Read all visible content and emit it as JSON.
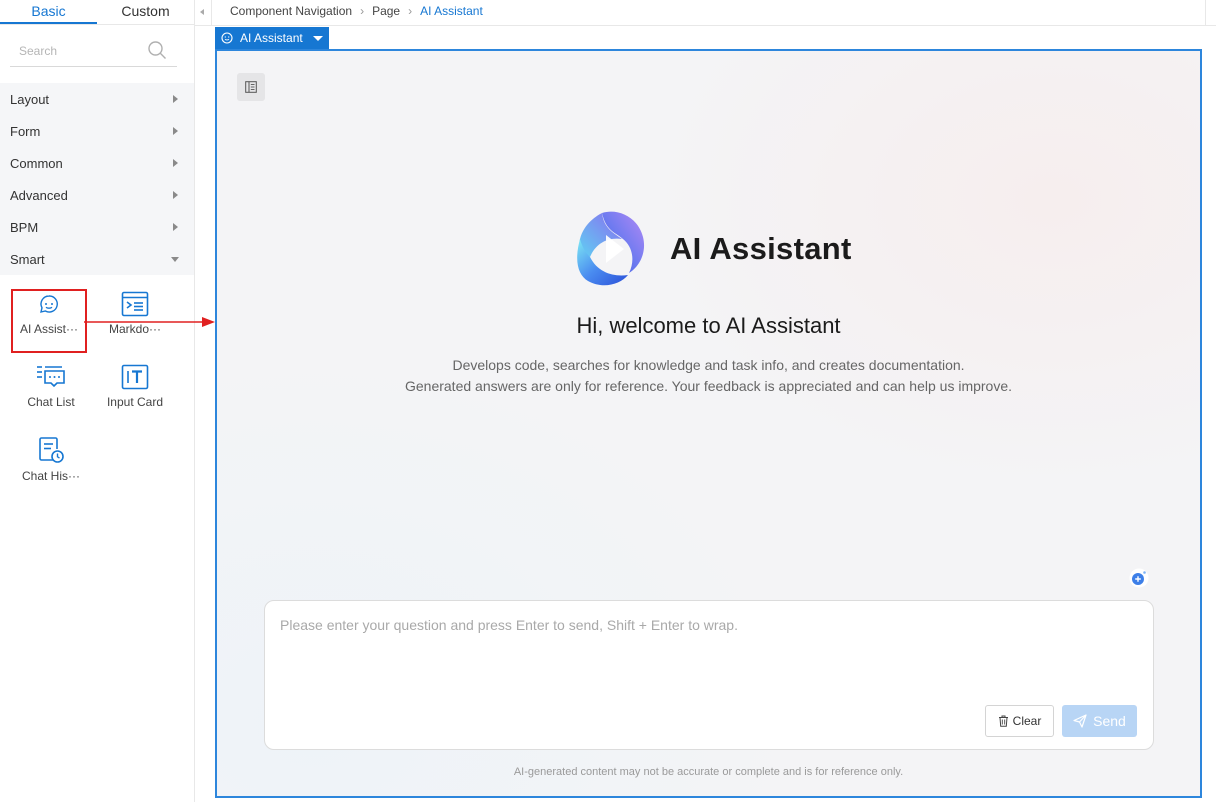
{
  "left_panel": {
    "tabs": [
      {
        "label": "Basic",
        "active": true
      },
      {
        "label": "Custom",
        "active": false
      }
    ],
    "search": {
      "placeholder": "Search",
      "value": ""
    },
    "categories": [
      {
        "label": "Layout",
        "expanded": false
      },
      {
        "label": "Form",
        "expanded": false
      },
      {
        "label": "Common",
        "expanded": false
      },
      {
        "label": "Advanced",
        "expanded": false
      },
      {
        "label": "BPM",
        "expanded": false
      },
      {
        "label": "Smart",
        "expanded": true
      }
    ],
    "components": [
      {
        "label": "AI Assist···",
        "icon": "ai-assistant-icon",
        "selected": true
      },
      {
        "label": "Markdo···",
        "icon": "markdown-icon",
        "selected": false
      },
      {
        "label": "Chat List",
        "icon": "chat-list-icon",
        "selected": false
      },
      {
        "label": "Input Card",
        "icon": "input-card-icon",
        "selected": false
      },
      {
        "label": "Chat His···",
        "icon": "chat-history-icon",
        "selected": false
      }
    ]
  },
  "breadcrumb": [
    "Component Navigation",
    "Page",
    "AI Assistant"
  ],
  "selected_tag": {
    "label": "AI Assistant",
    "icon": "smiley-chat-icon"
  },
  "canvas": {
    "brand_name": "AI Assistant",
    "welcome": "Hi, welcome to AI Assistant",
    "description_line1": "Develops code, searches for knowledge and task info, and creates documentation.",
    "description_line2": "Generated answers are only for reference. Your feedback is appreciated and can help us improve.",
    "input": {
      "placeholder": "Please enter your question and press Enter to send, Shift + Enter to wrap.",
      "value": ""
    },
    "clear_label": "Clear",
    "send_label": "Send",
    "disclaimer": "AI-generated content may not be accurate or complete and is for reference only."
  },
  "colors": {
    "accent": "#1677d2",
    "selection_border": "#e02020",
    "canvas_border": "#2d86dc",
    "send_disabled": "#b8d5f5"
  }
}
